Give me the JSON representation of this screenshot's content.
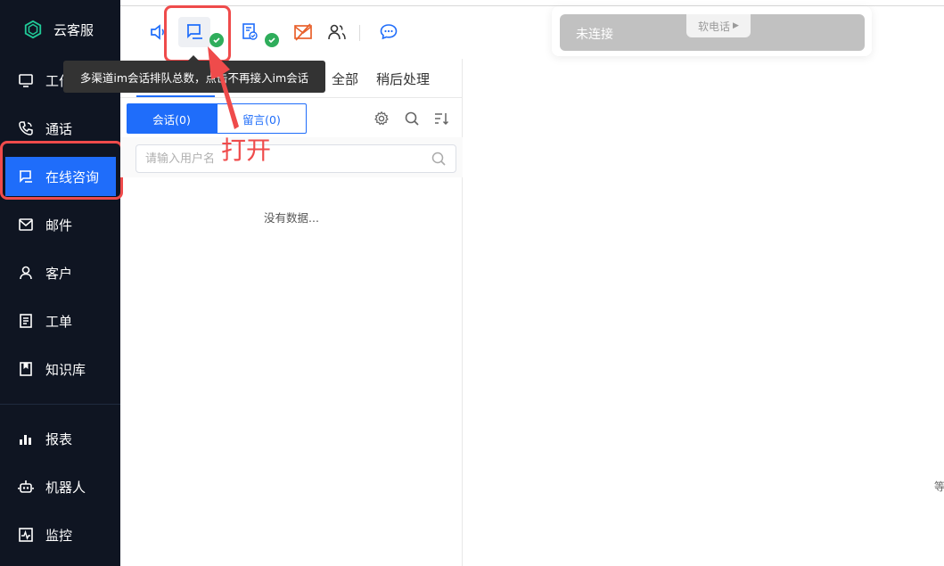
{
  "brand": {
    "name": "云客服",
    "color": "#1f6dfa"
  },
  "sidebar": {
    "items": [
      {
        "label": "工作台",
        "icon": "monitor-icon"
      },
      {
        "label": "通话",
        "icon": "phone-icon"
      },
      {
        "label": "在线咨询",
        "icon": "chat-icon",
        "active": true
      },
      {
        "label": "邮件",
        "icon": "mail-icon"
      },
      {
        "label": "客户",
        "icon": "user-icon"
      },
      {
        "label": "工单",
        "icon": "ticket-icon"
      },
      {
        "label": "知识库",
        "icon": "book-icon"
      },
      {
        "label": "报表",
        "icon": "bar-chart-icon"
      },
      {
        "label": "机器人",
        "icon": "robot-icon"
      },
      {
        "label": "监控",
        "icon": "monitor-pulse-icon"
      }
    ]
  },
  "toolbar": {
    "icons": [
      "speaker-icon",
      "im-chat-icon",
      "document-check-icon",
      "mail-off-icon",
      "users-icon",
      "chat-bubble-icon"
    ],
    "tooltip": "多渠道im会话排队总数，点击不再接入im会话"
  },
  "phone": {
    "status": "未连接",
    "label": "软电话"
  },
  "panel": {
    "tabs": [
      "全部",
      "稍后处理"
    ],
    "segments": {
      "conversations": "会话(0)",
      "messages": "留言(0)"
    },
    "search_placeholder": "请输入用户名",
    "empty_text": "没有数据..."
  },
  "annotation": {
    "text": "打开",
    "color": "#ef4b4b"
  },
  "edge_text": "等"
}
